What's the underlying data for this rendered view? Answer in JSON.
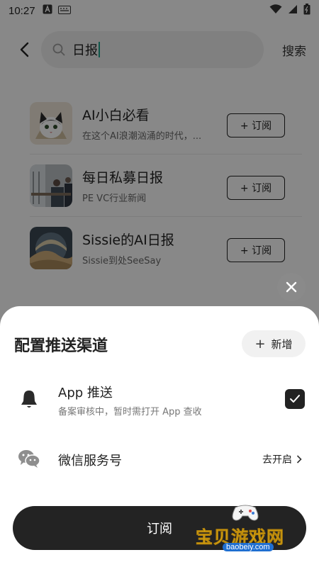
{
  "status_bar": {
    "time": "10:27"
  },
  "search": {
    "query": "日报",
    "action_label": "搜索"
  },
  "results": [
    {
      "title": "AI小白必看",
      "subtitle": "在这个AI浪潮汹涌的时代，...",
      "button": "+ 订阅"
    },
    {
      "title": "每日私募日报",
      "subtitle": "PE VC行业新闻",
      "button": "+ 订阅"
    },
    {
      "title": "Sissie的AI日报",
      "subtitle": "Sissie到处SeeSay",
      "button": "+ 订阅"
    }
  ],
  "sheet": {
    "title": "配置推送渠道",
    "add_label": "新增",
    "channels": [
      {
        "name": "App 推送",
        "desc": "备案审核中，暂时需打开 App 查收",
        "checked": true
      },
      {
        "name": "微信服务号",
        "action": "去开启"
      }
    ],
    "submit_label": "订阅"
  },
  "watermark": {
    "text": "宝贝游戏网",
    "url": "baobeiy.com"
  },
  "icons": {
    "back": "chevron-left-icon",
    "search": "search-icon",
    "close": "close-icon",
    "bell": "bell-icon",
    "wechat": "wechat-icon",
    "check": "check-icon",
    "chevron_right": "chevron-right-icon"
  },
  "colors": {
    "accent_dark": "#232323",
    "caret": "#1f9e89"
  }
}
